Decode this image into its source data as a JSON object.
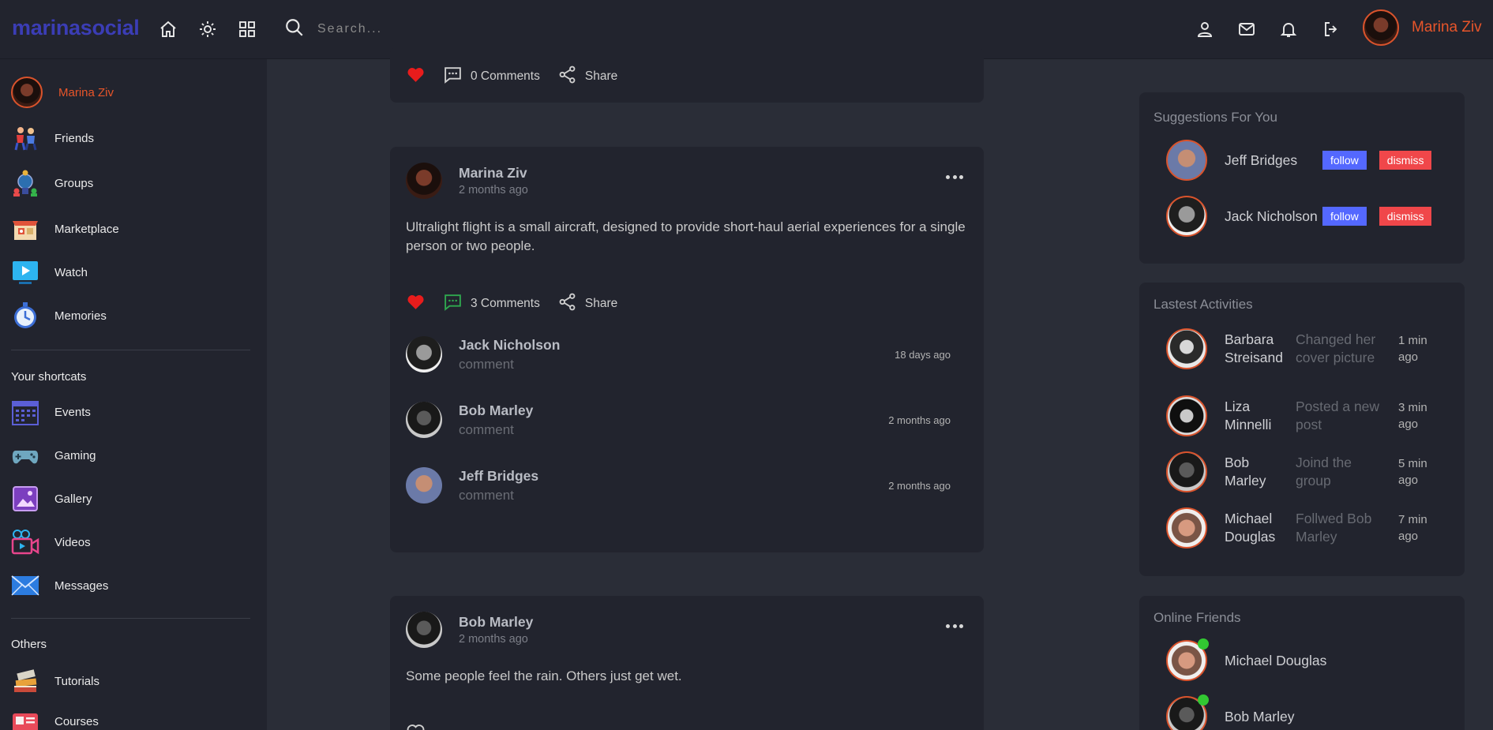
{
  "app": {
    "logo": "marinasocial"
  },
  "search": {
    "placeholder": "Search..."
  },
  "user": {
    "name": "Marina Ziv"
  },
  "sidebar": {
    "profile_name": "Marina Ziv",
    "main_items": [
      {
        "label": "Friends",
        "icon": "friends-icon"
      },
      {
        "label": "Groups",
        "icon": "groups-icon"
      },
      {
        "label": "Marketplace",
        "icon": "marketplace-icon"
      },
      {
        "label": "Watch",
        "icon": "watch-icon"
      },
      {
        "label": "Memories",
        "icon": "memories-icon"
      }
    ],
    "shortcuts_title": "Your shortcats",
    "shortcut_items": [
      {
        "label": "Events",
        "icon": "events-icon"
      },
      {
        "label": "Gaming",
        "icon": "gaming-icon"
      },
      {
        "label": "Gallery",
        "icon": "gallery-icon"
      },
      {
        "label": "Videos",
        "icon": "videos-icon"
      },
      {
        "label": "Messages",
        "icon": "messages-icon"
      }
    ],
    "others_title": "Others",
    "other_items": [
      {
        "label": "Tutorials",
        "icon": "tutorials-icon"
      },
      {
        "label": "Courses",
        "icon": "courses-icon"
      }
    ]
  },
  "feed": {
    "top_card": {
      "comments_label": "0 Comments",
      "share_label": "Share"
    },
    "post1": {
      "author": "Marina Ziv",
      "time": "2 months ago",
      "text": "Ultralight flight is a small aircraft, designed to provide short-haul aerial experiences for a single person or two people.",
      "comments_label": "3 Comments",
      "share_label": "Share",
      "comments": [
        {
          "name": "Jack Nicholson",
          "text": "comment",
          "time": "18 days ago"
        },
        {
          "name": "Bob Marley",
          "text": "comment",
          "time": "2 months ago"
        },
        {
          "name": "Jeff Bridges",
          "text": "comment",
          "time": "2 months ago"
        }
      ]
    },
    "post2": {
      "author": "Bob Marley",
      "time": "2 months ago",
      "text": "Some people feel the rain. Others just get wet."
    }
  },
  "suggestions": {
    "title": "Suggestions For You",
    "follow_label": "follow",
    "dismiss_label": "dismiss",
    "people": [
      {
        "name": "Jeff Bridges"
      },
      {
        "name": "Jack Nicholson"
      }
    ]
  },
  "activities": {
    "title": "Lastest Activities",
    "items": [
      {
        "name": "Barbara Streisand",
        "desc": "Changed her cover picture",
        "time": "1 min ago"
      },
      {
        "name": "Liza Minnelli",
        "desc": "Posted a new post",
        "time": "3 min ago"
      },
      {
        "name": "Bob Marley",
        "desc": "Joind the group",
        "time": "5 min ago"
      },
      {
        "name": "Michael Douglas",
        "desc": "Follwed Bob Marley",
        "time": "7 min ago"
      }
    ]
  },
  "online": {
    "title": "Online Friends",
    "friends": [
      {
        "name": "Michael Douglas"
      },
      {
        "name": "Bob Marley"
      }
    ]
  },
  "colors": {
    "brand": "#3b3db5",
    "accent_name": "#e8552a",
    "like": "#e81c1c",
    "follow": "#5468ff",
    "dismiss": "#f0474a",
    "online": "#32c832"
  }
}
